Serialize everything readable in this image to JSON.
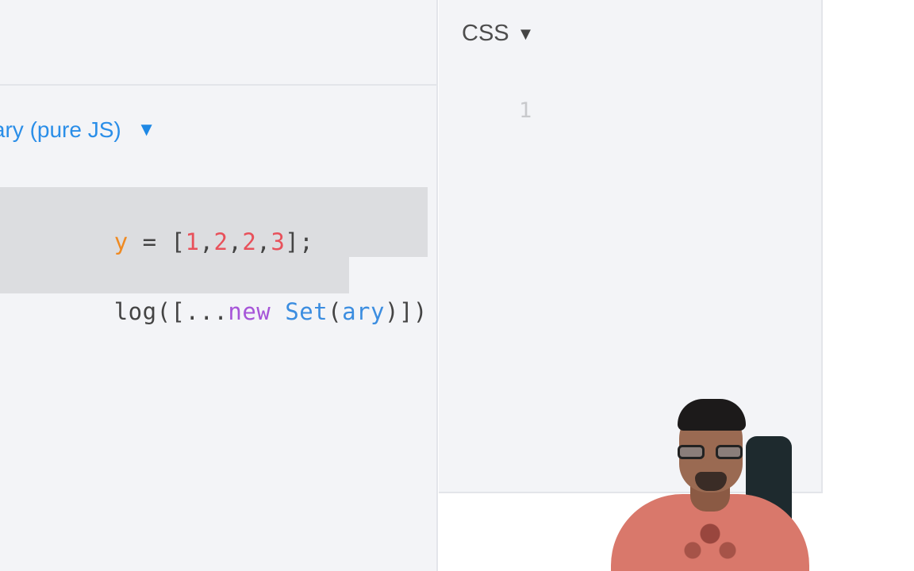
{
  "js_panel": {
    "language_label": "orary (pure JS)",
    "language_caret": "▼",
    "code_lines": [
      {
        "tokens": [
          {
            "text": "y",
            "kind": "var"
          },
          {
            "text": " = [",
            "kind": "punc"
          },
          {
            "text": "1",
            "kind": "num"
          },
          {
            "text": ",",
            "kind": "punc"
          },
          {
            "text": "2",
            "kind": "num"
          },
          {
            "text": ",",
            "kind": "punc"
          },
          {
            "text": "2",
            "kind": "num"
          },
          {
            "text": ",",
            "kind": "punc"
          },
          {
            "text": "3",
            "kind": "num"
          },
          {
            "text": "];",
            "kind": "punc"
          }
        ]
      },
      {
        "tokens": [
          {
            "text": "log([...",
            "kind": "punc"
          },
          {
            "text": "new",
            "kind": "kw"
          },
          {
            "text": " ",
            "kind": "punc"
          },
          {
            "text": "Set",
            "kind": "cls"
          },
          {
            "text": "(",
            "kind": "punc"
          },
          {
            "text": "ary",
            "kind": "arg"
          },
          {
            "text": ")])",
            "kind": "punc"
          }
        ]
      }
    ]
  },
  "css_panel": {
    "title": "CSS",
    "caret": "▼",
    "line_number": "1"
  },
  "colors": {
    "panel_bg": "#f3f4f7",
    "accent_blue": "#2a8ee8",
    "selection": "#dcdde0",
    "variable": "#ef8a22",
    "number": "#e8515b",
    "keyword": "#a655d8",
    "class": "#3b8de0"
  },
  "icons": {
    "language_dropdown": "chevron-down-icon",
    "css_dropdown": "chevron-down-icon"
  }
}
